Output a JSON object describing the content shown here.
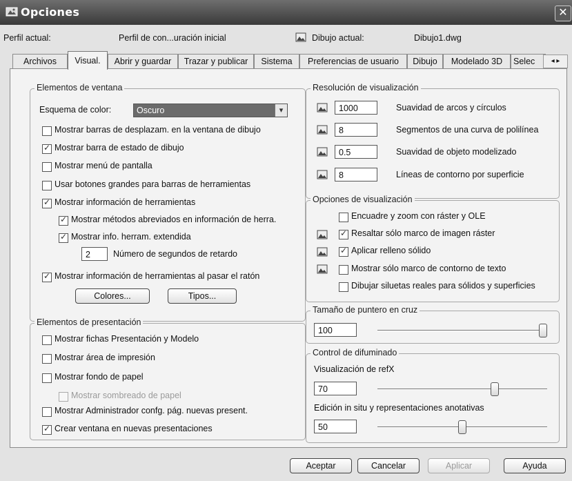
{
  "window": {
    "title": "Opciones",
    "close_glyph": "✕"
  },
  "profile": {
    "current_label": "Perfil actual:",
    "current_value": "Perfil de con...uración inicial",
    "drawing_label": "Dibujo actual:",
    "drawing_value": "Dibujo1.dwg"
  },
  "tabs": [
    {
      "label": "Archivos",
      "active": false
    },
    {
      "label": "Visual.",
      "active": true
    },
    {
      "label": "Abrir y guardar",
      "active": false
    },
    {
      "label": "Trazar y publicar",
      "active": false
    },
    {
      "label": "Sistema",
      "active": false
    },
    {
      "label": "Preferencias de usuario",
      "active": false
    },
    {
      "label": "Dibujo",
      "active": false
    },
    {
      "label": "Modelado 3D",
      "active": false
    },
    {
      "label": "Selec",
      "active": false
    }
  ],
  "tab_scroll": "◂ ▸",
  "window_elements": {
    "title": "Elementos de ventana",
    "color_scheme_label": "Esquema de color:",
    "color_scheme_value": "Oscuro",
    "options": [
      {
        "label": "Mostrar barras de desplazam. en la ventana de dibujo",
        "checked": false
      },
      {
        "label": "Mostrar barra de estado de dibujo",
        "checked": true
      },
      {
        "label": "Mostrar menú de pantalla",
        "checked": false
      },
      {
        "label": "Usar botones grandes para barras de herramientas",
        "checked": false
      },
      {
        "label": "Mostrar información de herramientas",
        "checked": true
      },
      {
        "label": "Mostrar métodos abreviados en información de herra.",
        "checked": true
      },
      {
        "label": "Mostrar info. herram. extendida",
        "checked": true
      },
      {
        "label": "Mostrar información de herramientas al pasar el ratón",
        "checked": true
      }
    ],
    "delay_value": "2",
    "delay_label": "Número de segundos de retardo",
    "colors_button": "Colores...",
    "fonts_button": "Tipos..."
  },
  "layout_elements": {
    "title": "Elementos de presentación",
    "options": [
      {
        "label": "Mostrar fichas Presentación y Modelo",
        "checked": false
      },
      {
        "label": "Mostrar área de impresión",
        "checked": false
      },
      {
        "label": "Mostrar fondo de papel",
        "checked": false
      },
      {
        "label": "Mostrar sombreado de papel",
        "checked": false,
        "disabled": true
      },
      {
        "label": "Mostrar Administrador confg. pág. nuevas present.",
        "checked": false
      },
      {
        "label": "Crear ventana en nuevas presentaciones",
        "checked": true
      }
    ]
  },
  "display_resolution": {
    "title": "Resolución de visualización",
    "rows": [
      {
        "value": "1000",
        "label": "Suavidad de arcos y círculos"
      },
      {
        "value": "8",
        "label": "Segmentos de una curva de polilínea"
      },
      {
        "value": "0.5",
        "label": "Suavidad de objeto modelizado"
      },
      {
        "value": "8",
        "label": "Líneas de contorno por superficie"
      }
    ]
  },
  "display_performance": {
    "title": "Opciones de visualización",
    "options": [
      {
        "label": "Encuadre y zoom con ráster y OLE",
        "checked": false
      },
      {
        "label": "Resaltar sólo marco de imagen ráster",
        "checked": true
      },
      {
        "label": "Aplicar relleno sólido",
        "checked": true
      },
      {
        "label": "Mostrar sólo marco de contorno de texto",
        "checked": false
      },
      {
        "label": "Dibujar siluetas reales para sólidos y superficies",
        "checked": false
      }
    ]
  },
  "crosshair": {
    "title": "Tamaño de puntero en cruz",
    "value": "100",
    "fraction": 1.0
  },
  "fade": {
    "title": "Control de difuminado",
    "xref_label": "Visualización de refX",
    "xref_value": "70",
    "xref_fraction": 0.7,
    "inplace_label": "Edición in situ y representaciones anotativas",
    "inplace_value": "50",
    "inplace_fraction": 0.5
  },
  "buttons": {
    "ok": "Aceptar",
    "cancel": "Cancelar",
    "apply": "Aplicar",
    "help": "Ayuda"
  },
  "colors": {
    "titlebar_dark": "#3a3a3a",
    "panel_bg": "#f3f3f3",
    "select_bg": "#6b6b6b"
  },
  "icons": [
    "window-icon",
    "drawing-icon",
    "setting-icon"
  ]
}
